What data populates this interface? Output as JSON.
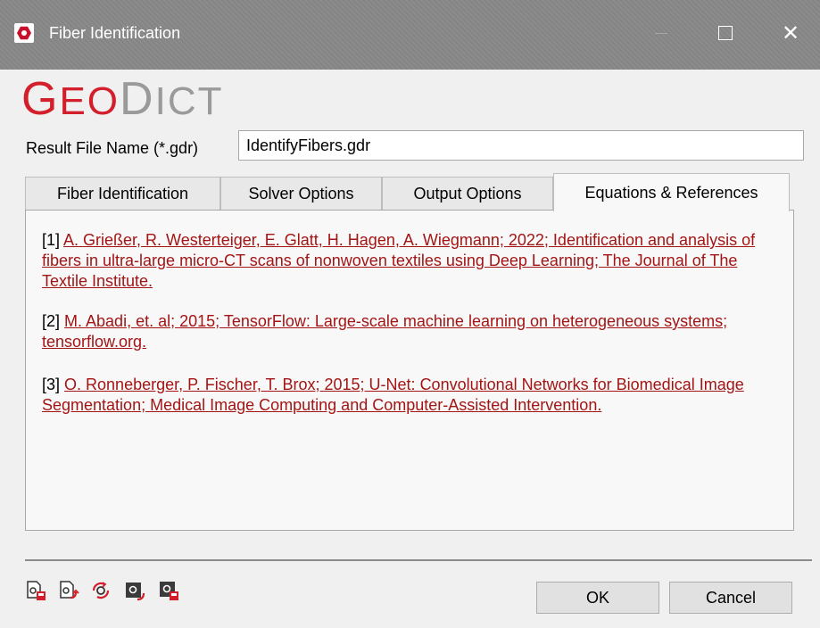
{
  "window": {
    "title": "Fiber Identification",
    "minimize_symbol": "—",
    "close_symbol": "✕"
  },
  "logo": {
    "geo_first": "G",
    "geo_rest": "EO",
    "dict_first": "D",
    "dict_rest": "ICT"
  },
  "result_file": {
    "label": "Result File Name (*.gdr)",
    "value": "IdentifyFibers.gdr"
  },
  "tabs": [
    {
      "label": "Fiber Identification"
    },
    {
      "label": "Solver Options"
    },
    {
      "label": "Output Options"
    },
    {
      "label": "Equations & References",
      "active": true
    }
  ],
  "references": [
    {
      "num": "[1]",
      "text": "A. Grießer, R. Westerteiger, E. Glatt, H. Hagen, A. Wiegmann; 2022; Identification and analysis of fibers in ultra-large micro-CT scans of nonwoven textiles using Deep Learning; The Journal of The Textile Institute."
    },
    {
      "num": "[2]",
      "text": "M. Abadi, et. al; 2015; TensorFlow: Large-scale machine learning on heterogeneous systems; tensorflow.org."
    },
    {
      "num": "[3]",
      "text": "O. Ronneberger, P. Fischer, T. Brox; 2015; U-Net: Convolutional Networks for Biomedical Image Segmentation; Medical Image Computing and Computer-Assisted Intervention."
    }
  ],
  "toolbar_icons": [
    "settings-save-icon",
    "settings-load-icon",
    "settings-reset-icon",
    "settings-import-icon",
    "settings-export-icon"
  ],
  "buttons": {
    "ok": "OK",
    "cancel": "Cancel"
  },
  "colors": {
    "brand_red": "#d21f2b",
    "link": "#a31515",
    "titlebar": "#888888"
  }
}
